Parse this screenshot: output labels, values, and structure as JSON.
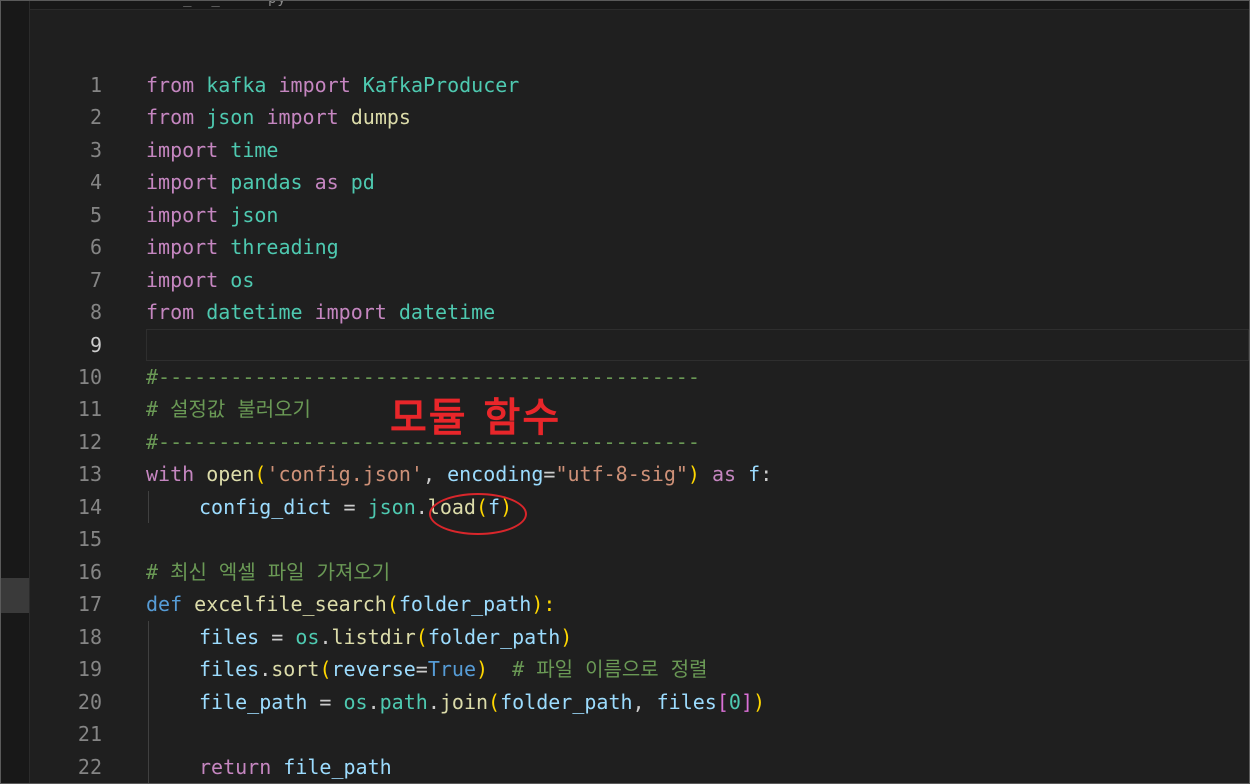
{
  "tab": {
    "label": "·    _  _  ·  py"
  },
  "editor": {
    "active_line": 9,
    "line_numbers": [
      "1",
      "2",
      "3",
      "4",
      "5",
      "6",
      "7",
      "8",
      "9",
      "10",
      "11",
      "12",
      "13",
      "14",
      "15",
      "16",
      "17",
      "18",
      "19",
      "20",
      "21",
      "22"
    ]
  },
  "code": {
    "l1": [
      "from",
      "kafka",
      "import",
      "KafkaProducer"
    ],
    "l2": [
      "from",
      "json",
      "import",
      "dumps"
    ],
    "l3": [
      "import",
      "time"
    ],
    "l4": [
      "import",
      "pandas",
      "as",
      "pd"
    ],
    "l5": [
      "import",
      "json"
    ],
    "l6": [
      "import",
      "threading"
    ],
    "l7": [
      "import",
      "os"
    ],
    "l8": [
      "from",
      "datetime",
      "import",
      "datetime"
    ],
    "l10": "#---------------------------------------------",
    "l11": "# 설정값 불러오기",
    "l12": "#---------------------------------------------",
    "l13": [
      "with",
      "open",
      "(",
      "'config.json'",
      ", ",
      "encoding",
      "=",
      "\"utf-8-sig\"",
      ")",
      "as",
      "f",
      ":"
    ],
    "l14": [
      "config_dict",
      " = ",
      "json",
      ".",
      "load",
      "(",
      "f",
      ")"
    ],
    "l16": "# 최신 엑셀 파일 가져오기",
    "l17": [
      "def",
      "excelfile_search",
      "(",
      "folder_path",
      "):"
    ],
    "l18": [
      "files",
      " = ",
      "os",
      ".",
      "listdir",
      "(",
      "folder_path",
      ")"
    ],
    "l19": [
      "files",
      ".",
      "sort",
      "(",
      "reverse",
      "=",
      "True",
      ")",
      "# 파일 이름으로 정렬"
    ],
    "l20": [
      "file_path",
      " = ",
      "os",
      ".",
      "path",
      ".",
      "join",
      "(",
      "folder_path",
      ", ",
      "files",
      "[",
      "0",
      "]",
      ")"
    ],
    "l22": [
      "return",
      "file_path"
    ]
  },
  "annotation": {
    "text": "모듈 함수",
    "color": "#e8262a"
  }
}
